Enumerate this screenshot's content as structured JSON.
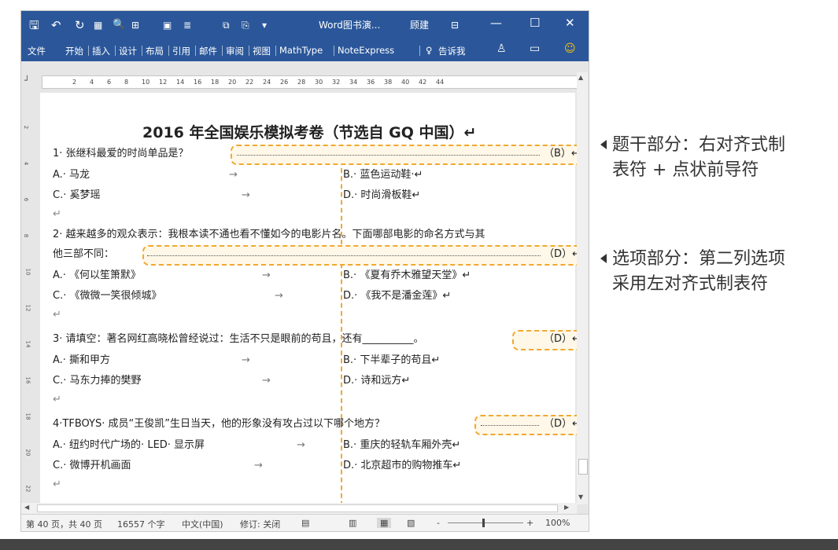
{
  "titlebar": {
    "doc_title": "Word图书演...",
    "user": "顾建",
    "icons": [
      "save-icon",
      "undo-icon",
      "redo-icon",
      "print-preview-icon",
      "min-icon",
      "max-icon",
      "close-icon"
    ],
    "minimize": "—",
    "maximize": "☐",
    "close": "✕"
  },
  "ribbon": {
    "tabs": [
      "文件",
      "开始",
      "插入",
      "设计",
      "布局",
      "引用",
      "邮件",
      "审阅",
      "视图",
      "MathType",
      "NoteExpress"
    ],
    "tell_me": "告诉我"
  },
  "ruler": [
    "2",
    "4",
    "6",
    "8",
    "10",
    "12",
    "14",
    "16",
    "18",
    "20",
    "22",
    "24",
    "26",
    "28",
    "30",
    "32",
    "34",
    "36",
    "38",
    "40",
    "42",
    "44"
  ],
  "vruler": [
    "2",
    "4",
    "6",
    "8",
    "10",
    "12",
    "14",
    "16",
    "18",
    "20",
    "22"
  ],
  "doc": {
    "title": "2016 年全国娱乐模拟考卷（节选自 GQ 中国）↵",
    "q1": "1· 张继科最爱的时尚单品是？",
    "q1_ans": "（B）↵",
    "q1_a": "A.· 马龙",
    "q1_b": "B.· 蓝色运动鞋·↵",
    "q1_c": "C.· 奚梦瑶",
    "q1_d": "D.· 时尚滑板鞋↵",
    "q2_l1": "2· 越来越多的观众表示：我根本读不通也看不懂如今的电影片名。下面哪部电影的命名方式与其",
    "q2_l2": "他三部不同：",
    "q2_ans": "（D）↵",
    "q2_a": "A.· 《何以笙箫默》",
    "q2_b": "B.· 《夏有乔木雅望天堂》↵",
    "q2_c": "C.· 《微微一笑很倾城》",
    "q2_d": "D.· 《我不是潘金莲》↵",
    "q3": "3· 请填空：著名网红高晓松曾经说过：生活不只是眼前的苟且，还有__________。",
    "q3_ans": "（D）↵",
    "q3_a": "A.· 撕和甲方",
    "q3_b": "B.· 下半辈子的苟且↵",
    "q3_c": "C.· 马东力捧的樊野",
    "q3_d": "D.· 诗和远方↵",
    "q4": "4·TFBOYS· 成员“王俊凯”生日当天，他的形象没有攻占过以下哪个地方？",
    "q4_ans": "（D）↵",
    "q4_a": "A.· 纽约时代广场的· LED· 显示屏",
    "q4_b": "B.· 重庆的轻轨车厢外壳↵",
    "q4_c": "C.· 微博开机画面",
    "q4_d": "D.· 北京超市的购物推车↵",
    "para": "↵",
    "tab_arrow": "→"
  },
  "status": {
    "page": "第 40 页，共 40 页",
    "words": "16557 个字",
    "lang": "中文(中国)",
    "track": "修订: 关闭",
    "zoom_minus": "-",
    "zoom_plus": "+",
    "zoom": "100%"
  },
  "callouts": {
    "c1_l1": "题干部分：右对齐式制",
    "c1_l2": "表符 + 点状前导符",
    "c2_l1": "选项部分：第二列选项",
    "c2_l2": "采用左对齐式制表符"
  },
  "colors": {
    "accent": "#2b579a",
    "highlight": "#f0a830"
  }
}
